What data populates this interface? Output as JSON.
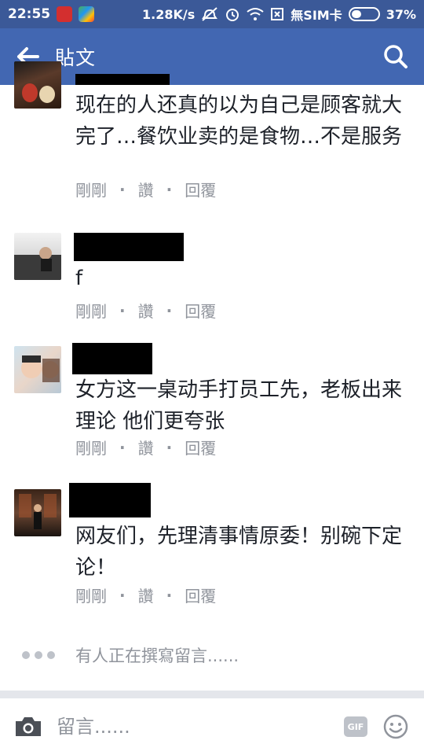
{
  "status_bar": {
    "time": "22:55",
    "speed": "1.28K/s",
    "carrier": "無SIM卡",
    "battery": "37%"
  },
  "app_bar": {
    "title": "貼文"
  },
  "comments": [
    {
      "text": "现在的人还真的以为自己是顾客就大完了…餐饮业卖的是食物…不是服务",
      "time": "剛剛",
      "like": "讚",
      "reply": "回覆"
    },
    {
      "text": "f",
      "time": "剛剛",
      "like": "讚",
      "reply": "回覆"
    },
    {
      "text": "女方这一桌动手打员工先，老板出来理论 他们更夸张",
      "time": "剛剛",
      "like": "讚",
      "reply": "回覆"
    },
    {
      "text": "网友们，先理清事情原委！别碗下定论！",
      "time": "剛剛",
      "like": "讚",
      "reply": "回覆"
    }
  ],
  "typing_indicator": "有人正在撰寫留言......",
  "composer": {
    "placeholder": "留言......",
    "gif_label": "GIF"
  },
  "colors": {
    "status_bar": "#3b5998",
    "app_bar": "#4267b2",
    "meta_text": "#90949c"
  },
  "icons": [
    "back-arrow-icon",
    "search-icon",
    "camera-icon",
    "gif-icon",
    "emoji-icon",
    "wifi-icon",
    "alarm-icon",
    "mute-icon"
  ]
}
